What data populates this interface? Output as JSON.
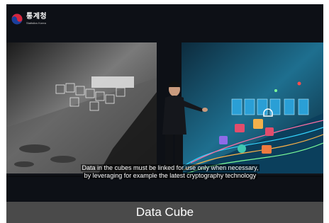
{
  "logo": {
    "name": "통계청",
    "subtitle": "Statistics Korea"
  },
  "subtitle": {
    "line1": "Data in the cubes must be linked for use only when necessary,",
    "line2": "by leveraging for example the latest cryptography technology"
  },
  "caption": "Data Cube",
  "colors": {
    "caption_bg": "#4a4a4a",
    "frame_bg": "#0d1016",
    "left_scene": "#8a8a8a",
    "right_scene": "#1e6f8f",
    "accent_cyan": "#35d6ff"
  }
}
